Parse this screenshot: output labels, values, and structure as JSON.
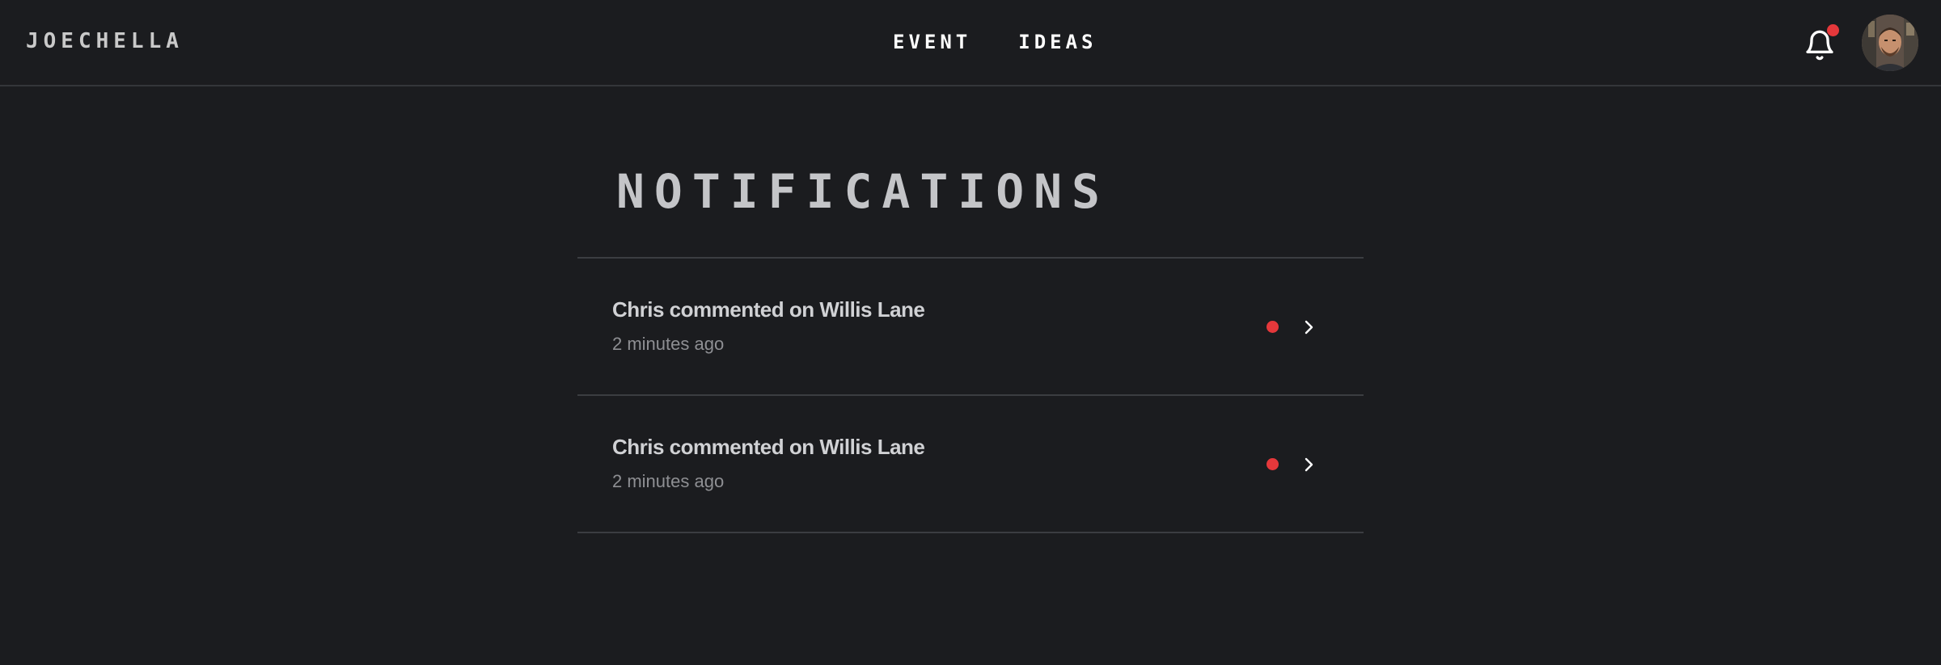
{
  "header": {
    "brand": "JOECHELLA",
    "nav": [
      {
        "label": "EVENT"
      },
      {
        "label": "IDEAS"
      }
    ],
    "notifications_icon": "bell-icon",
    "has_unread": true,
    "avatar": "user-avatar"
  },
  "main": {
    "title": "NOTIFICATIONS",
    "notifications": [
      {
        "text": "Chris commented on Willis Lane",
        "time": "2 minutes ago",
        "unread": true
      },
      {
        "text": "Chris commented on Willis Lane",
        "time": "2 minutes ago",
        "unread": true
      }
    ]
  },
  "colors": {
    "background": "#1b1c1f",
    "accent_red": "#e5383b",
    "divider": "#3b3d41",
    "text_primary": "#d0d1d4",
    "text_secondary": "#8e8f93"
  }
}
